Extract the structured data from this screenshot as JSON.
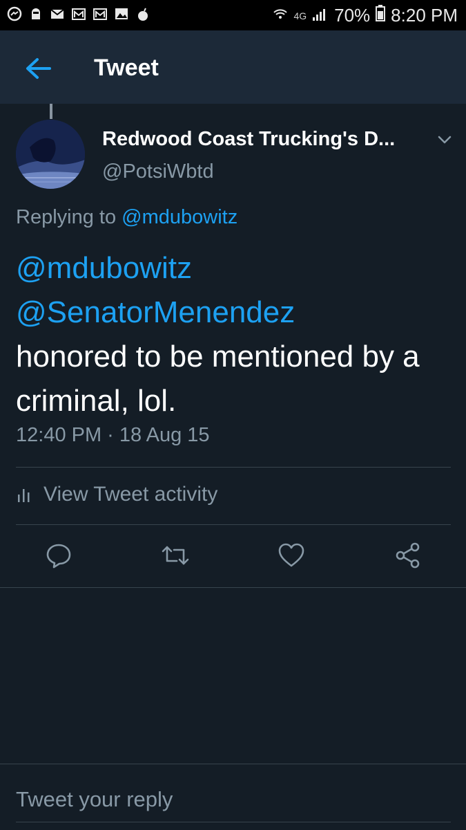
{
  "status_bar": {
    "icons_left": [
      "messenger-icon",
      "ghost-icon",
      "mail-icon",
      "gmail-icon",
      "gmail-icon",
      "image-icon",
      "bomb-icon"
    ],
    "network": "4G",
    "battery": "70%",
    "time": "8:20 PM"
  },
  "app_bar": {
    "title": "Tweet"
  },
  "tweet": {
    "display_name": "Redwood Coast Trucking's D...",
    "handle": "@PotsiWbtd",
    "replying_prefix": "Replying to",
    "replying_to": "@mdubowitz",
    "mentions": [
      "@mdubowitz",
      "@SenatorMenendez"
    ],
    "text": "honored to be mentioned by a criminal, lol.",
    "timestamp": "12:40 PM · 18 Aug 15",
    "activity_label": "View Tweet activity"
  },
  "reply": {
    "placeholder": "Tweet your reply"
  },
  "colors": {
    "background": "#141d26",
    "app_bar": "#1c2938",
    "accent": "#1da1f2",
    "secondary_text": "#8899a6",
    "divider": "#38444d"
  }
}
